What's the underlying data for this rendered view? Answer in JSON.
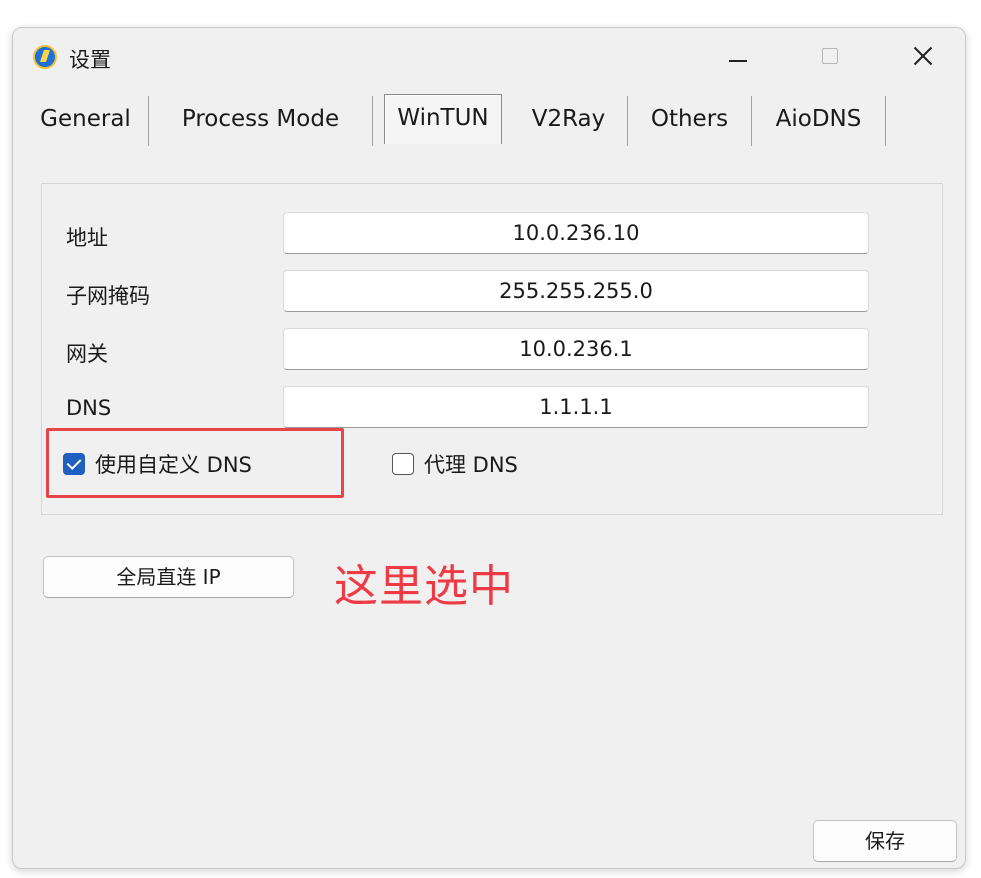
{
  "window": {
    "title": "设置",
    "controls": {
      "minimize": "minimize",
      "maximize": "maximize",
      "close": "close"
    }
  },
  "tabs": [
    {
      "label": "General",
      "active": false
    },
    {
      "label": "Process Mode",
      "active": false
    },
    {
      "label": "WinTUN",
      "active": true
    },
    {
      "label": "V2Ray",
      "active": false
    },
    {
      "label": "Others",
      "active": false
    },
    {
      "label": "AioDNS",
      "active": false
    }
  ],
  "form": {
    "fields": [
      {
        "label": "地址",
        "value": "10.0.236.10"
      },
      {
        "label": "子网掩码",
        "value": "255.255.255.0"
      },
      {
        "label": "网关",
        "value": "10.0.236.1"
      },
      {
        "label": "DNS",
        "value": "1.1.1.1"
      }
    ],
    "use_custom_dns": {
      "label": "使用自定义 DNS",
      "checked": true
    },
    "proxy_dns": {
      "label": "代理 DNS",
      "checked": false
    }
  },
  "buttons": {
    "global_direct_ip": "全局直连 IP",
    "save": "保存"
  },
  "annotation": {
    "text": "这里选中",
    "color": "#ee3a44"
  },
  "colors": {
    "accent": "#1f5fbf",
    "highlight": "#e8454b"
  }
}
